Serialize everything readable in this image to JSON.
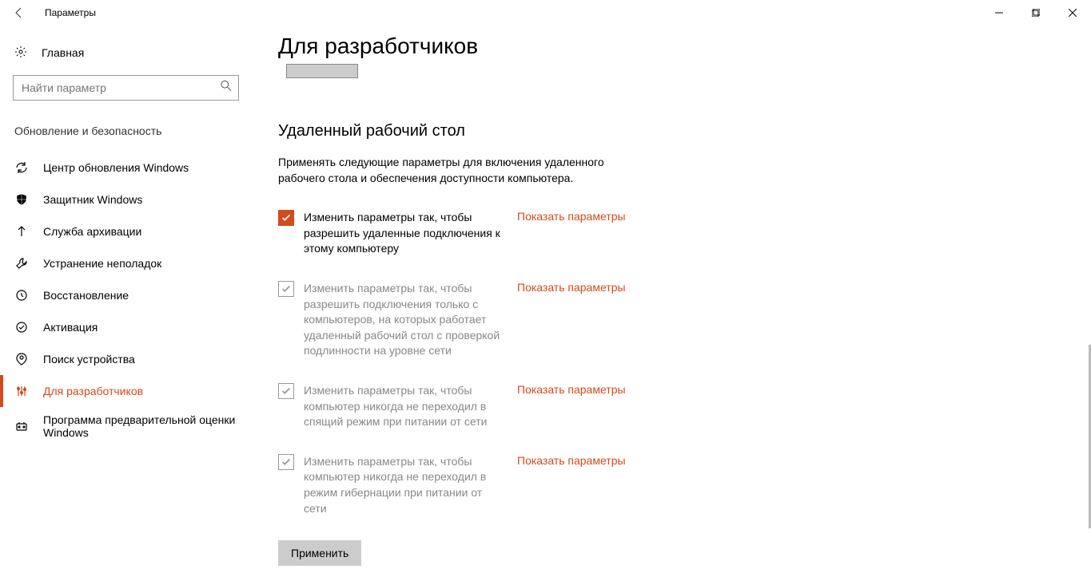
{
  "window": {
    "title": "Параметры"
  },
  "sidebar": {
    "home": "Главная",
    "search_placeholder": "Найти параметр",
    "category": "Обновление и безопасность",
    "items": [
      {
        "label": "Центр обновления Windows"
      },
      {
        "label": "Защитник Windows"
      },
      {
        "label": "Служба архивации"
      },
      {
        "label": "Устранение неполадок"
      },
      {
        "label": "Восстановление"
      },
      {
        "label": "Активация"
      },
      {
        "label": "Поиск устройства"
      },
      {
        "label": "Для разработчиков"
      },
      {
        "label": "Программа предварительной оценки Windows"
      }
    ]
  },
  "main": {
    "heading": "Для разработчиков",
    "cutoff_button": "Применить",
    "section": {
      "title": "Удаленный рабочий стол",
      "desc": "Применять следующие параметры для включения удаленного рабочего стола и обеспечения доступности компьютера."
    },
    "link": "Показать параметры",
    "options": [
      {
        "label": "Изменить параметры так, чтобы разрешить удаленные подключения к этому компьютеру",
        "checked": true,
        "disabled": false
      },
      {
        "label": "Изменить параметры так, чтобы разрешить подключения только с компьютеров, на которых работает удаленный рабочий стол с проверкой подлинности на уровне сети",
        "checked": true,
        "disabled": true
      },
      {
        "label": "Изменить параметры так, чтобы компьютер никогда не переходил в спящий режим при питании от сети",
        "checked": true,
        "disabled": true
      },
      {
        "label": "Изменить параметры так, чтобы компьютер никогда не переходил в режим гибернации при питании от сети",
        "checked": true,
        "disabled": true
      }
    ],
    "apply": "Применить"
  }
}
